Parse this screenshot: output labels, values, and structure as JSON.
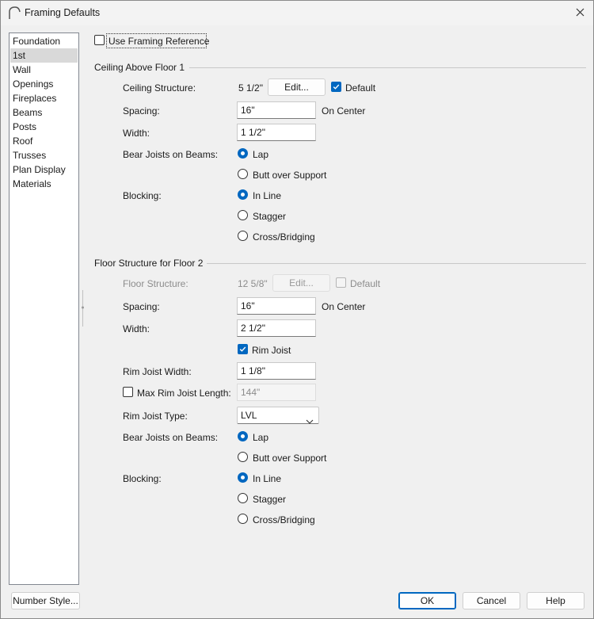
{
  "window": {
    "title": "Framing Defaults"
  },
  "sidebar": {
    "items": [
      {
        "label": "Foundation",
        "selected": false
      },
      {
        "label": "1st",
        "selected": true
      },
      {
        "label": "Wall",
        "selected": false
      },
      {
        "label": "Openings",
        "selected": false
      },
      {
        "label": "Fireplaces",
        "selected": false
      },
      {
        "label": "Beams",
        "selected": false
      },
      {
        "label": "Posts",
        "selected": false
      },
      {
        "label": "Roof",
        "selected": false
      },
      {
        "label": "Trusses",
        "selected": false
      },
      {
        "label": "Plan Display",
        "selected": false
      },
      {
        "label": "Materials",
        "selected": false
      }
    ]
  },
  "use_framing_reference": {
    "label": "Use Framing Reference",
    "checked": false
  },
  "ceiling": {
    "title": "Ceiling Above Floor 1",
    "structure_label": "Ceiling Structure:",
    "structure_value": "5 1/2\"",
    "edit_label": "Edit...",
    "default_label": "Default",
    "default_checked": true,
    "spacing_label": "Spacing:",
    "spacing_value": "16\"",
    "on_center": "On Center",
    "width_label": "Width:",
    "width_value": "1 1/2\"",
    "bear_label": "Bear Joists on Beams:",
    "bear_options": [
      "Lap",
      "Butt over Support"
    ],
    "bear_selected": "Lap",
    "blocking_label": "Blocking:",
    "blocking_options": [
      "In Line",
      "Stagger",
      "Cross/Bridging"
    ],
    "blocking_selected": "In Line"
  },
  "floor": {
    "title": "Floor Structure for Floor 2",
    "structure_label": "Floor Structure:",
    "structure_value": "12 5/8\"",
    "edit_label": "Edit...",
    "default_label": "Default",
    "default_checked": false,
    "spacing_label": "Spacing:",
    "spacing_value": "16\"",
    "on_center": "On Center",
    "width_label": "Width:",
    "width_value": "2 1/2\"",
    "rim_joist_label": "Rim Joist",
    "rim_joist_checked": true,
    "rim_width_label": "Rim Joist Width:",
    "rim_width_value": "1 1/8\"",
    "max_rim_label": "Max Rim Joist Length:",
    "max_rim_checked": false,
    "max_rim_value": "144\"",
    "rim_type_label": "Rim Joist Type:",
    "rim_type_value": "LVL",
    "bear_label": "Bear Joists on Beams:",
    "bear_options": [
      "Lap",
      "Butt over Support"
    ],
    "bear_selected": "Lap",
    "blocking_label": "Blocking:",
    "blocking_options": [
      "In Line",
      "Stagger",
      "Cross/Bridging"
    ],
    "blocking_selected": "In Line"
  },
  "footer": {
    "number_style": "Number Style...",
    "ok": "OK",
    "cancel": "Cancel",
    "help": "Help"
  },
  "colors": {
    "accent": "#0067c0",
    "background": "#f0f0f0",
    "selection": "#d9d9d9"
  },
  "icons": {
    "app": "arch-icon",
    "close": "close-icon",
    "dropdown": "chevron-down-icon",
    "check": "check-icon"
  }
}
